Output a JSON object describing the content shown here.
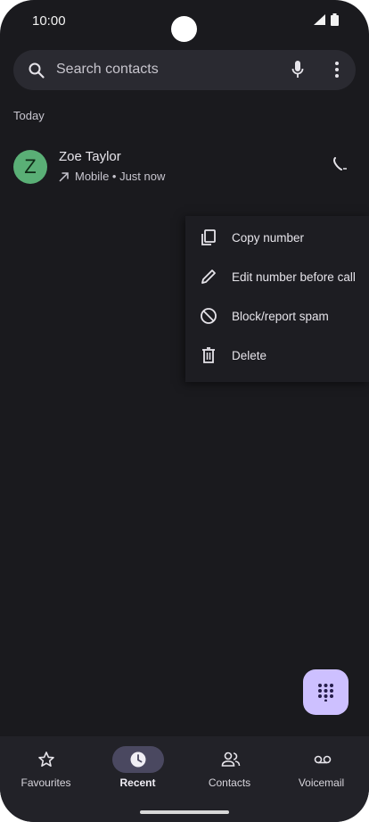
{
  "status_bar": {
    "time": "10:00"
  },
  "search": {
    "placeholder": "Search contacts"
  },
  "list": {
    "section_header": "Today",
    "items": [
      {
        "avatar_letter": "Z",
        "avatar_color": "#5aaf76",
        "name": "Zoe Taylor",
        "call_type_icon": "outgoing-arrow-icon",
        "detail": "Mobile • Just now"
      }
    ]
  },
  "context_menu": {
    "items": [
      {
        "label": "Copy number",
        "icon": "copy-icon"
      },
      {
        "label": "Edit number before call",
        "icon": "pencil-icon"
      },
      {
        "label": "Block/report spam",
        "icon": "block-icon"
      },
      {
        "label": "Delete",
        "icon": "trash-icon"
      }
    ]
  },
  "fab": {
    "icon": "dialpad-icon",
    "color": "#cdc0ff"
  },
  "bottom_nav": {
    "active": "Recent",
    "items": [
      {
        "label": "Favourites",
        "icon": "star-icon"
      },
      {
        "label": "Recent",
        "icon": "clock-icon"
      },
      {
        "label": "Contacts",
        "icon": "people-icon"
      },
      {
        "label": "Voicemail",
        "icon": "voicemail-icon"
      }
    ]
  }
}
